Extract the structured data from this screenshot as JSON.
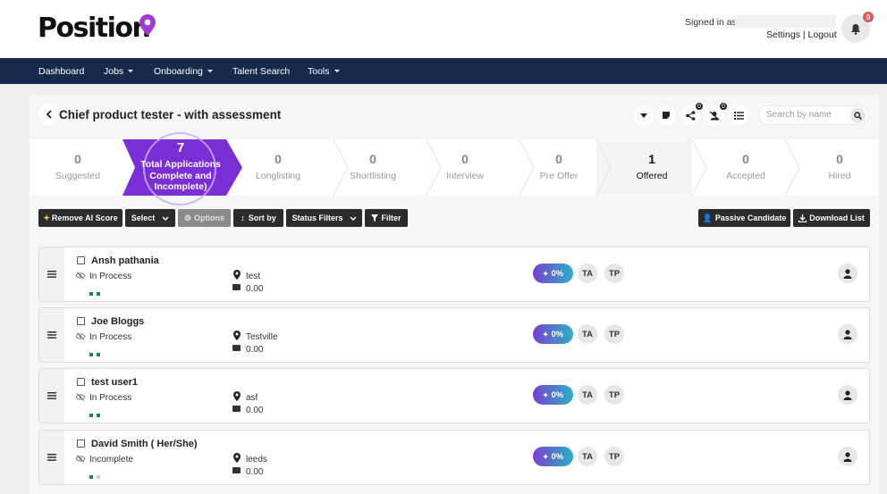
{
  "brand": {
    "name": "Position",
    "accent": "#a23bd6"
  },
  "account": {
    "signed_in_label": "Signed in as",
    "settings": "Settings",
    "separator": "|",
    "logout": "Logout",
    "notifications": "0"
  },
  "nav": [
    {
      "label": "Dashboard",
      "dropdown": false
    },
    {
      "label": "Jobs",
      "dropdown": true
    },
    {
      "label": "Onboarding",
      "dropdown": true
    },
    {
      "label": "Talent Search",
      "dropdown": false
    },
    {
      "label": "Tools",
      "dropdown": true
    }
  ],
  "job": {
    "title": "Chief product tester - with assessment",
    "share_count": "0",
    "assign_count": "0",
    "search_placeholder": "Search by name"
  },
  "pipeline": {
    "active": {
      "count": "7",
      "label_line1": "Total Applications",
      "label_line2": "Complete and",
      "label_line3": "Incomplete)"
    },
    "stages": [
      {
        "count": "0",
        "label": "Suggested"
      },
      {
        "count": "0",
        "label": "Longlisting"
      },
      {
        "count": "0",
        "label": "Shortlisting"
      },
      {
        "count": "0",
        "label": "Interview"
      },
      {
        "count": "0",
        "label": "Pre Offer"
      },
      {
        "count": "1",
        "label": "Offered"
      },
      {
        "count": "0",
        "label": "Accepted"
      },
      {
        "count": "0",
        "label": "Hired"
      }
    ]
  },
  "toolbar": {
    "remove_ai": "Remove AI Score",
    "select": "Select",
    "options": "Options",
    "sort_by": "Sort by",
    "status_filters": "Status Filters",
    "filter": "Filter",
    "passive": "Passive Candidate",
    "download": "Download List"
  },
  "candidates": [
    {
      "name": "Ansh pathania",
      "status": "In Process",
      "location": "test",
      "salary": "0.00",
      "ai_score": "0%",
      "badge1": "TA",
      "badge2": "TP"
    },
    {
      "name": "Joe Bloggs",
      "status": "In Process",
      "location": "Testville",
      "salary": "0.00",
      "ai_score": "0%",
      "badge1": "TA",
      "badge2": "TP"
    },
    {
      "name": "test user1",
      "status": "In Process",
      "location": "asf",
      "salary": "0.00",
      "ai_score": "0%",
      "badge1": "TA",
      "badge2": "TP"
    },
    {
      "name": "David Smith ( Her/She)",
      "status": "Incomplete",
      "location": "leeds",
      "salary": "0.00",
      "ai_score": "0%",
      "badge1": "TA",
      "badge2": "TP"
    }
  ]
}
